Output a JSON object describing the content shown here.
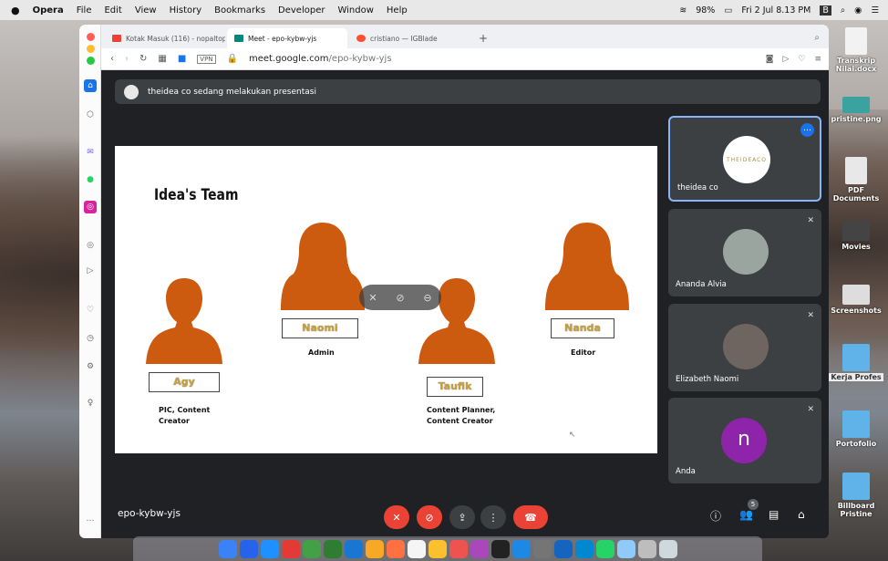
{
  "menubar": {
    "app": "Opera",
    "items": [
      "File",
      "Edit",
      "View",
      "History",
      "Bookmarks",
      "Developer",
      "Window",
      "Help"
    ],
    "battery": "98%",
    "datetime": "Fri 2 Jul  8.13 PM"
  },
  "desktop": {
    "icons": [
      {
        "label": "Transkrip Nilai.docx",
        "icon": "document-icon"
      },
      {
        "label": "pristine.png",
        "icon": "image-icon"
      },
      {
        "label": "PDF Documents",
        "icon": "folder-icon"
      },
      {
        "label": "Movies",
        "icon": "folder-icon"
      },
      {
        "label": "Screenshots",
        "icon": "folder-icon"
      },
      {
        "label": "Kerja Profes",
        "icon": "folder-icon"
      },
      {
        "label": "Portofolio",
        "icon": "folder-icon"
      },
      {
        "label": "Billboard Pristine",
        "icon": "folder-icon"
      }
    ]
  },
  "browser": {
    "tabs": [
      {
        "label": "Kotak Masuk (116) - nopaltopi...",
        "icon": "gmail-icon",
        "active": false
      },
      {
        "label": "Meet - epo-kybw-yjs",
        "icon": "meet-icon",
        "active": true
      },
      {
        "label": "cristiano — IGBlade",
        "icon": "igblade-icon",
        "active": false
      }
    ],
    "new_tab": "+",
    "url_host": "meet.google.com",
    "url_path": "/epo-kybw-yjs",
    "vpn": "VPN"
  },
  "meet": {
    "banner": "theidea co sedang melakukan presentasi",
    "meeting_code": "epo-kybw-yjs",
    "participant_count": "5",
    "participants": [
      {
        "name": "theidea co",
        "logo": "THEIDEACO",
        "muted": false,
        "active": true
      },
      {
        "name": "Ananda Alvia",
        "muted": true
      },
      {
        "name": "Elizabeth Naomi",
        "muted": true
      },
      {
        "name": "Anda",
        "initial": "n",
        "muted": true
      }
    ],
    "avatar_color": "#8e24aa",
    "end_call_color": "#ea4335"
  },
  "slide": {
    "title": "Idea's Team",
    "members": [
      {
        "name": "Agy",
        "role": "PIC, Content Creator"
      },
      {
        "name": "Naomi",
        "role": "Admin"
      },
      {
        "name": "Taufik",
        "role": "Content Planner, Content Creator"
      },
      {
        "name": "Nanda",
        "role": "Editor"
      }
    ],
    "person_color": "#cc5a0f"
  }
}
